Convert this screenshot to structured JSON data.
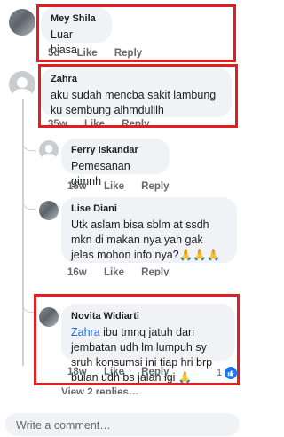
{
  "comments": [
    {
      "name": "Mey Shila",
      "text": "Luar biasa",
      "time": "5d",
      "like": "Like",
      "reply": "Reply"
    },
    {
      "name": "Zahra",
      "text": "aku sudah mencba sakit lambung ku sembung alhmdulilh",
      "time": "35w",
      "like": "Like",
      "reply": "Reply"
    },
    {
      "name": "Ferry Iskandar",
      "text": "Pemesanan gimnh",
      "time": "15w",
      "like": "Like",
      "reply": "Reply"
    },
    {
      "name": "Lise Diani",
      "text": "Utk aslam bisa sblm at ssdh mkn di makan nya yah gak jelas mohon info nya?🙏🙏🙏",
      "time": "16w",
      "like": "Like",
      "reply": "Reply"
    },
    {
      "name": "Novita Widiarti",
      "mention": "Zahra",
      "text": " ibu tmnq jatuh dari jembatan udh lm lumpuh sy sruh konsumsi ini tiap hri brp bulan udh bs jalan lgi 🙏",
      "time": "18w",
      "like": "Like",
      "reply": "Reply",
      "reactions": "1"
    }
  ],
  "view_replies": "View 2 replies…",
  "composer": {
    "placeholder": "Write a comment…"
  },
  "colors": {
    "highlight": "#e02020",
    "link": "#216fdb",
    "bubble": "#f0f2f5",
    "like_badge": "#1877f2"
  },
  "icons": [
    "avatar-photo",
    "avatar-default",
    "like-reaction-icon"
  ]
}
